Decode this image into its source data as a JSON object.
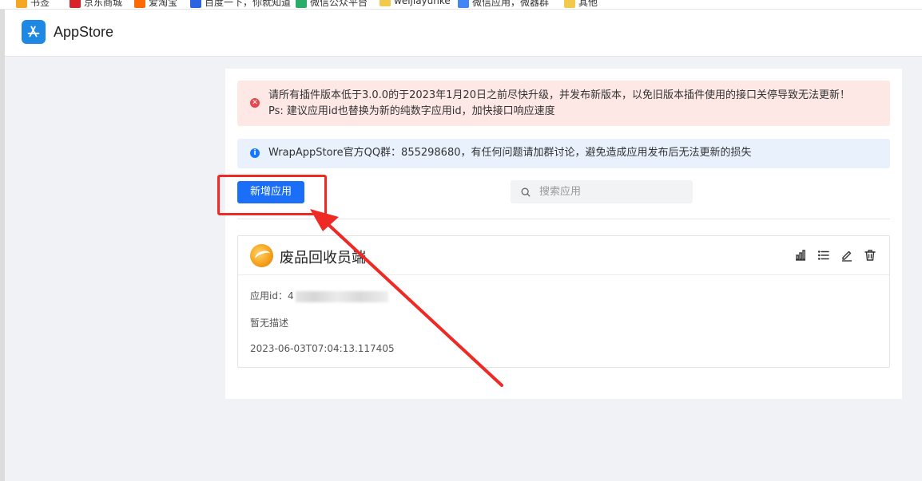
{
  "browser": {
    "bookmarks": [
      {
        "label": "书签",
        "color": "#f5a623"
      },
      {
        "label": "京东商城",
        "color": "#d8232a"
      },
      {
        "label": "爱淘宝",
        "color": "#ff6a00"
      },
      {
        "label": "百度一下，你就知道",
        "color": "#2b63e0"
      },
      {
        "label": "微信公众平台",
        "color": "#2aae67"
      },
      {
        "label": "weijiayunke",
        "color": "#f2c94c"
      },
      {
        "label": "微信应用，微器群",
        "color": "#4285f4"
      },
      {
        "label": "其他",
        "color": "#f2c94c"
      }
    ]
  },
  "header": {
    "title": "AppStore",
    "logo_icon": "app-store-icon",
    "accent": "#1e88e5"
  },
  "alerts": {
    "error": {
      "line1": "请所有插件版本低于3.0.0的于2023年1月20日之前尽快升级，并发布新版本，以免旧版本插件使用的接口关停导致无法更新！",
      "line2": "Ps: 建议应用id也替换为新的纯数字应用id，加快接口响应速度",
      "icon": "close-circle-icon",
      "color": "#e5484d"
    },
    "info": {
      "line1": "WrapAppStore官方QQ群：855298680，有任何问题请加群讨论，避免造成应用发布后无法更新的损失",
      "icon": "info-circle-icon",
      "color": "#1677ff"
    }
  },
  "toolbar": {
    "add_label": "新增应用",
    "search_placeholder": "搜索应用",
    "search_value": ""
  },
  "apps": [
    {
      "name": "废品回收员端",
      "id_label": "应用id：",
      "id_value": "4",
      "description": "暂无描述",
      "created": "2023-06-03T07:04:13.117405",
      "actions": [
        "stats-icon",
        "list-icon",
        "edit-icon",
        "delete-icon"
      ]
    }
  ],
  "annotation": {
    "color": "#ee2a24"
  }
}
